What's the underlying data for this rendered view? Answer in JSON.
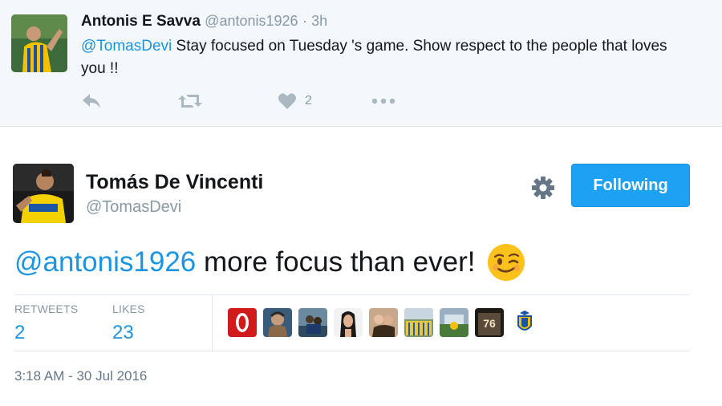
{
  "colors": {
    "link": "#1b95e0",
    "follow_button": "#1da1f2",
    "muted": "#8899a6",
    "reply_bg": "#f5f8fa"
  },
  "reply_tweet": {
    "author_name": "Antonis E Savva",
    "author_handle": "@antonis1926",
    "separator": "·",
    "time": "3h",
    "mention": "@TomasDevi",
    "text": " Stay focused on Tuesday 's game. Show respect to the people that loves you !!",
    "actions": {
      "reply_icon": "reply-icon",
      "retweet_icon": "retweet-icon",
      "like_icon": "heart-icon",
      "like_count": "2",
      "more_icon": "more-icon"
    }
  },
  "main_tweet": {
    "author_name": "Tomás De Vincenti",
    "author_handle": "@TomasDevi",
    "settings_icon": "gear-icon",
    "follow_label": "Following",
    "mention": "@antonis1926",
    "text": " more focus than ever!",
    "emoji": "winking-face-emoji",
    "retweets_label": "RETWEETS",
    "retweets_count": "2",
    "likes_label": "LIKES",
    "likes_count": "23",
    "timestamp": "3:18 AM - 30 Jul 2016"
  }
}
